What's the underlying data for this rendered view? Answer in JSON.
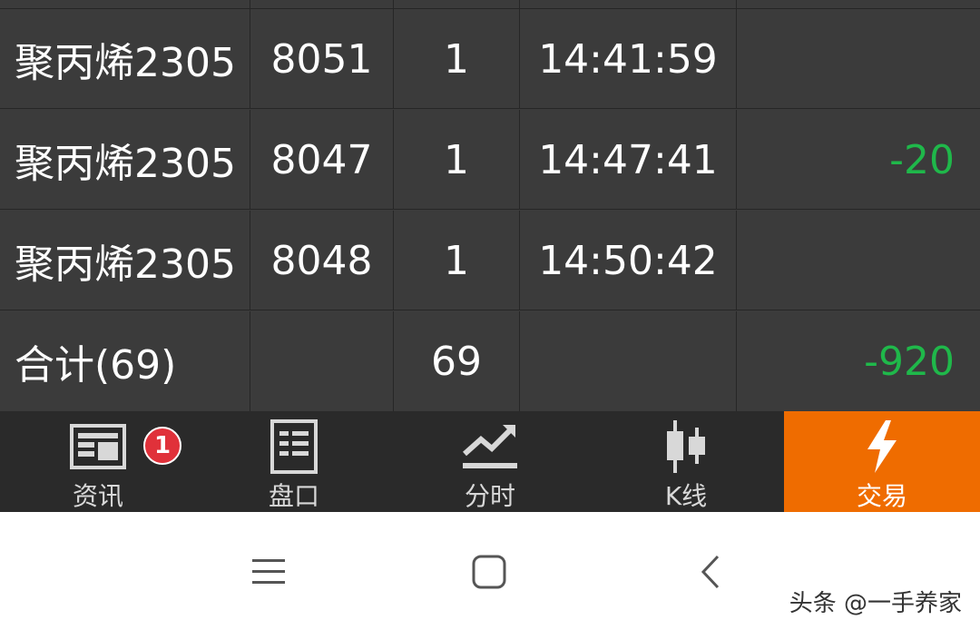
{
  "table": {
    "rows": [
      {
        "name": "聚丙烯2305",
        "price": "8051",
        "qty": "1",
        "time": "14:41:59",
        "pl": ""
      },
      {
        "name": "聚丙烯2305",
        "price": "8047",
        "qty": "1",
        "time": "14:47:41",
        "pl": "-20"
      },
      {
        "name": "聚丙烯2305",
        "price": "8048",
        "qty": "1",
        "time": "14:50:42",
        "pl": ""
      }
    ],
    "total": {
      "label": "合计(69)",
      "qty": "69",
      "pl": "-920"
    }
  },
  "tabbar": {
    "tabs": [
      {
        "label": "资讯",
        "icon": "news-icon",
        "badge": "1"
      },
      {
        "label": "盘口",
        "icon": "order-book-icon"
      },
      {
        "label": "分时",
        "icon": "timeshare-chart-icon"
      },
      {
        "label": "K线",
        "icon": "candlestick-icon"
      },
      {
        "label": "交易",
        "icon": "lightning-icon",
        "active": true
      }
    ]
  },
  "navbar": {
    "buttons": [
      {
        "icon": "menu-icon"
      },
      {
        "icon": "home-icon"
      },
      {
        "icon": "back-icon"
      }
    ]
  },
  "watermark": "头条 @一手养家",
  "colors": {
    "background": "#3b3b3b",
    "tabbar": "#2a2a2a",
    "active_tab": "#ef6c00",
    "loss": "#1fb84a",
    "badge": "#e0313a"
  }
}
